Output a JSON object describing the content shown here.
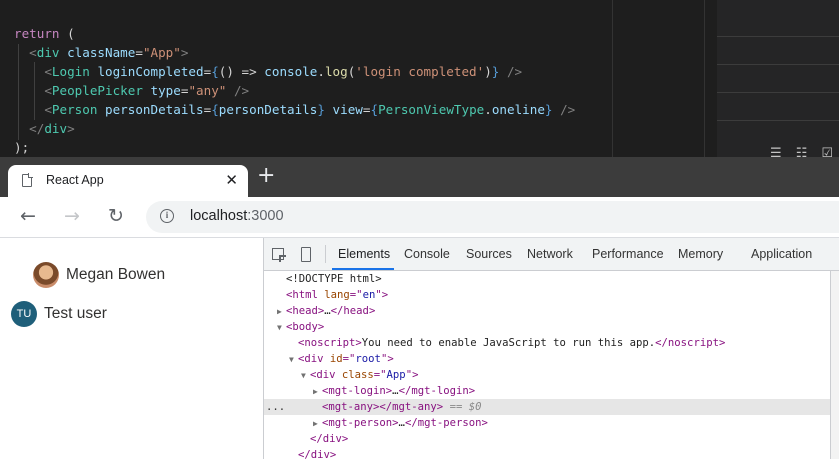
{
  "editor": {
    "lines": [
      {
        "tokens": [
          {
            "t": "return",
            "c": "t-kw"
          },
          {
            "t": " (",
            "c": "t-punc"
          }
        ]
      },
      {
        "tokens": [
          {
            "t": "  <",
            "c": "t-br"
          },
          {
            "t": "div",
            "c": "t-tag"
          },
          {
            "t": " ",
            "c": "t-punc"
          },
          {
            "t": "className",
            "c": "t-attr"
          },
          {
            "t": "=",
            "c": "t-punc"
          },
          {
            "t": "\"App\"",
            "c": "t-str"
          },
          {
            "t": ">",
            "c": "t-br"
          }
        ]
      },
      {
        "tokens": [
          {
            "t": "    <",
            "c": "t-br"
          },
          {
            "t": "Login",
            "c": "t-tag"
          },
          {
            "t": " ",
            "c": "t-punc"
          },
          {
            "t": "loginCompleted",
            "c": "t-attr"
          },
          {
            "t": "=",
            "c": "t-punc"
          },
          {
            "t": "{",
            "c": "t-brace"
          },
          {
            "t": "() => ",
            "c": "t-punc"
          },
          {
            "t": "console",
            "c": "t-attr"
          },
          {
            "t": ".",
            "c": "t-punc"
          },
          {
            "t": "log",
            "c": "t-fn"
          },
          {
            "t": "(",
            "c": "t-punc"
          },
          {
            "t": "'login completed'",
            "c": "t-str"
          },
          {
            "t": ")",
            "c": "t-punc"
          },
          {
            "t": "}",
            "c": "t-brace"
          },
          {
            "t": " />",
            "c": "t-br"
          }
        ]
      },
      {
        "tokens": [
          {
            "t": "    <",
            "c": "t-br"
          },
          {
            "t": "PeoplePicker",
            "c": "t-tag"
          },
          {
            "t": " ",
            "c": "t-punc"
          },
          {
            "t": "type",
            "c": "t-attr"
          },
          {
            "t": "=",
            "c": "t-punc"
          },
          {
            "t": "\"any\"",
            "c": "t-str"
          },
          {
            "t": " />",
            "c": "t-br"
          }
        ]
      },
      {
        "tokens": [
          {
            "t": "    <",
            "c": "t-br"
          },
          {
            "t": "Person",
            "c": "t-tag"
          },
          {
            "t": " ",
            "c": "t-punc"
          },
          {
            "t": "personDetails",
            "c": "t-attr"
          },
          {
            "t": "=",
            "c": "t-punc"
          },
          {
            "t": "{",
            "c": "t-brace"
          },
          {
            "t": "personDetails",
            "c": "t-attr"
          },
          {
            "t": "}",
            "c": "t-brace"
          },
          {
            "t": " ",
            "c": "t-punc"
          },
          {
            "t": "view",
            "c": "t-attr"
          },
          {
            "t": "=",
            "c": "t-punc"
          },
          {
            "t": "{",
            "c": "t-brace"
          },
          {
            "t": "PersonViewType",
            "c": "t-tag"
          },
          {
            "t": ".",
            "c": "t-punc"
          },
          {
            "t": "oneline",
            "c": "t-attr"
          },
          {
            "t": "}",
            "c": "t-brace"
          },
          {
            "t": " />",
            "c": "t-br"
          }
        ]
      },
      {
        "tokens": [
          {
            "t": "  </",
            "c": "t-br"
          },
          {
            "t": "div",
            "c": "t-tag"
          },
          {
            "t": ">",
            "c": "t-br"
          }
        ]
      },
      {
        "tokens": [
          {
            "t": ");",
            "c": "t-punc"
          }
        ]
      }
    ]
  },
  "browser": {
    "tab": {
      "title": "React App",
      "close": "✕"
    },
    "new_tab": "+",
    "nav": {
      "back": "←",
      "forward": "→",
      "reload": "↻"
    },
    "omnibox": {
      "host": "localhost",
      "port": ":3000"
    }
  },
  "page": {
    "people": [
      {
        "name": "Megan Bowen"
      },
      {
        "name": "Test user",
        "initials": "TU"
      }
    ]
  },
  "devtools": {
    "tabs": [
      "Elements",
      "Console",
      "Sources",
      "Network",
      "Performance",
      "Memory",
      "Application"
    ],
    "active_tab": "Elements",
    "dom_rows": [
      {
        "indent": 0,
        "tri": "",
        "html": [
          {
            "t": "<!DOCTYPE html>",
            "c": "d-txt"
          }
        ]
      },
      {
        "indent": 0,
        "tri": "",
        "html": [
          {
            "t": "<html ",
            "c": "d-tag"
          },
          {
            "t": "lang",
            "c": "d-attr"
          },
          {
            "t": "=\"",
            "c": "d-tag"
          },
          {
            "t": "en",
            "c": "d-val"
          },
          {
            "t": "\">",
            "c": "d-tag"
          }
        ]
      },
      {
        "indent": 0,
        "tri": "▶",
        "html": [
          {
            "t": "<head>",
            "c": "d-tag"
          },
          {
            "t": "…",
            "c": "d-txt"
          },
          {
            "t": "</head>",
            "c": "d-tag"
          }
        ]
      },
      {
        "indent": 0,
        "tri": "▼",
        "html": [
          {
            "t": "<body>",
            "c": "d-tag"
          }
        ]
      },
      {
        "indent": 1,
        "tri": "",
        "html": [
          {
            "t": "<noscript>",
            "c": "d-tag"
          },
          {
            "t": "You need to enable JavaScript to run this app.",
            "c": "d-txt"
          },
          {
            "t": "</noscript>",
            "c": "d-tag"
          }
        ]
      },
      {
        "indent": 1,
        "tri": "▼",
        "html": [
          {
            "t": "<div ",
            "c": "d-tag"
          },
          {
            "t": "id",
            "c": "d-attr"
          },
          {
            "t": "=\"",
            "c": "d-tag"
          },
          {
            "t": "root",
            "c": "d-val"
          },
          {
            "t": "\">",
            "c": "d-tag"
          }
        ]
      },
      {
        "indent": 2,
        "tri": "▼",
        "html": [
          {
            "t": "<div ",
            "c": "d-tag"
          },
          {
            "t": "class",
            "c": "d-attr"
          },
          {
            "t": "=\"",
            "c": "d-tag"
          },
          {
            "t": "App",
            "c": "d-val"
          },
          {
            "t": "\">",
            "c": "d-tag"
          }
        ]
      },
      {
        "indent": 3,
        "tri": "▶",
        "html": [
          {
            "t": "<mgt-login>",
            "c": "d-tag"
          },
          {
            "t": "…",
            "c": "d-txt"
          },
          {
            "t": "</mgt-login>",
            "c": "d-tag"
          }
        ]
      },
      {
        "indent": 3,
        "tri": "",
        "selected": true,
        "html": [
          {
            "t": "<mgt-any>",
            "c": "d-tag"
          },
          {
            "t": "</mgt-any>",
            "c": "d-tag"
          },
          {
            "t": " == $0",
            "c": "d-eq"
          }
        ]
      },
      {
        "indent": 3,
        "tri": "▶",
        "html": [
          {
            "t": "<mgt-person>",
            "c": "d-tag"
          },
          {
            "t": "…",
            "c": "d-txt"
          },
          {
            "t": "</mgt-person>",
            "c": "d-tag"
          }
        ]
      },
      {
        "indent": 2,
        "tri": "",
        "html": [
          {
            "t": "</div>",
            "c": "d-tag"
          }
        ]
      },
      {
        "indent": 1,
        "tri": "",
        "html": [
          {
            "t": "</div>",
            "c": "d-tag"
          }
        ]
      }
    ],
    "selected_marker": "..."
  }
}
